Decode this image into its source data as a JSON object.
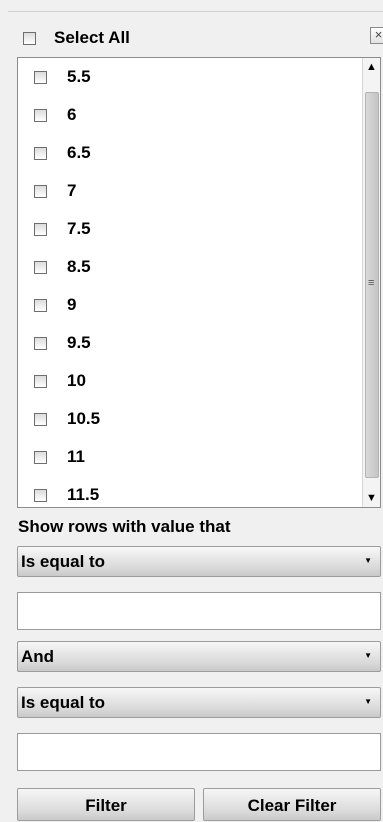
{
  "filter_panel": {
    "select_all_label": "Select All",
    "close_glyph": "×",
    "values": [
      "5.5",
      "6",
      "6.5",
      "7",
      "7.5",
      "8.5",
      "9",
      "9.5",
      "10",
      "10.5",
      "11",
      "11.5"
    ],
    "scroll_up_glyph": "▲",
    "scroll_down_glyph": "▼",
    "scroll_grip_glyph": "≡",
    "show_rows_label": "Show rows with value that",
    "condition1": {
      "selected": "Is equal to",
      "value": ""
    },
    "logic": {
      "selected": "And"
    },
    "condition2": {
      "selected": "Is equal to",
      "value": ""
    },
    "dropdown_arrow_glyph": "▼",
    "filter_button": "Filter",
    "clear_filter_button": "Clear Filter"
  }
}
